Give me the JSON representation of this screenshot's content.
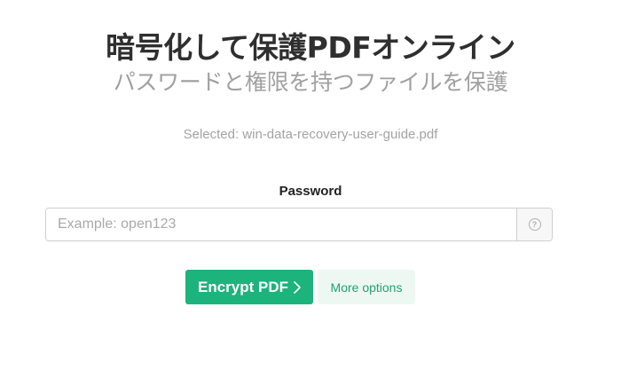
{
  "hero": {
    "title": "暗号化して保護PDFオンライン",
    "subtitle": "パスワードと権限を持つファイルを保護"
  },
  "file": {
    "selected_text": "Selected: win-data-recovery-user-guide.pdf"
  },
  "password": {
    "label": "Password",
    "placeholder": "Example: open123",
    "value": "",
    "help_icon": "question-circle-icon",
    "help_glyph": "?"
  },
  "actions": {
    "encrypt_label": "Encrypt PDF",
    "encrypt_icon": "chevron-right-icon",
    "more_options_label": "More options"
  },
  "colors": {
    "primary_green": "#1cb47c",
    "more_options_bg": "#eef8f3",
    "more_options_text": "#1fa46f",
    "subtitle_gray": "#a0a0a0"
  }
}
